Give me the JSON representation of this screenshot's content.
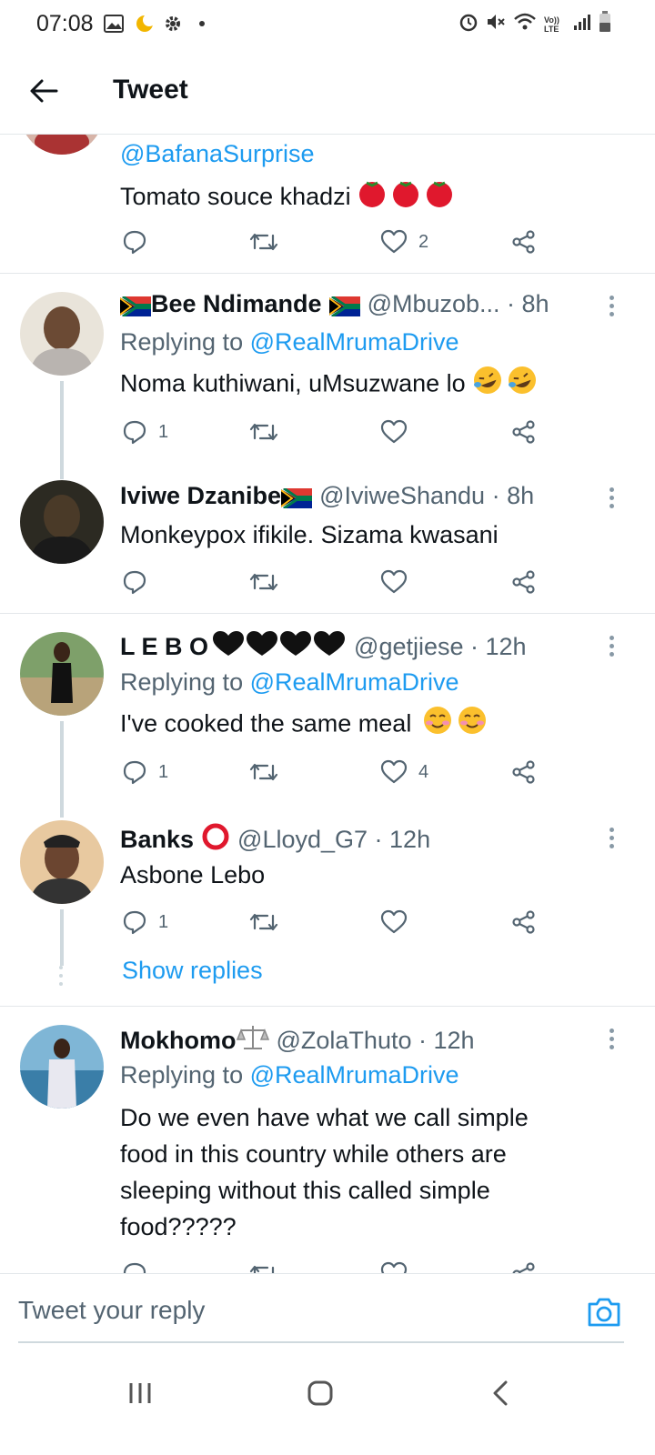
{
  "status_bar": {
    "time": "07:08",
    "network_label": "Vo)) LTE"
  },
  "header": {
    "title": "Tweet"
  },
  "tweets": [
    {
      "mention": "@BafanaSurprise",
      "text": "Tomato souce khadzi",
      "actions": {
        "replies": "",
        "retweets": "",
        "likes": "2"
      }
    },
    {
      "name": "Bee Ndimande",
      "handle": "@Mbuzob... · 8h",
      "replying_prefix": "Replying to ",
      "replying_to": "@RealMrumaDrive",
      "text": "Noma kuthiwani, uMsuzwane lo",
      "actions": {
        "replies": "1",
        "retweets": "",
        "likes": ""
      }
    },
    {
      "name": "Iviwe Dzanibe",
      "handle": "@IviweShandu · 8h",
      "text": "Monkeypox ifikile. Sizama kwasani",
      "actions": {
        "replies": "",
        "retweets": "",
        "likes": ""
      }
    },
    {
      "name": "L E B O",
      "handle": "@getjiese · 12h",
      "replying_prefix": "Replying to ",
      "replying_to": "@RealMrumaDrive",
      "text": "I've cooked the same meal",
      "actions": {
        "replies": "1",
        "retweets": "",
        "likes": "4"
      }
    },
    {
      "name": "Banks",
      "handle": "@Lloyd_G7 · 12h",
      "text": "Asbone Lebo",
      "actions": {
        "replies": "1",
        "retweets": "",
        "likes": ""
      },
      "show_replies": "Show replies"
    },
    {
      "name": "Mokhomo",
      "handle": "@ZolaThuto · 12h",
      "replying_prefix": "Replying to ",
      "replying_to": "@RealMrumaDrive",
      "text_lines": [
        "Do we even have what we call simple",
        "food in this country while others are",
        "sleeping without this called simple",
        "food?????"
      ]
    }
  ],
  "reply_bar": {
    "placeholder": "Tweet your reply"
  },
  "colors": {
    "accent": "#1d9bf0",
    "secondary_text": "#536471",
    "divider": "#e3e7ea"
  },
  "icons": [
    "back-arrow-icon",
    "comment-icon",
    "retweet-icon",
    "heart-icon",
    "share-icon",
    "more-icon",
    "camera-icon"
  ]
}
